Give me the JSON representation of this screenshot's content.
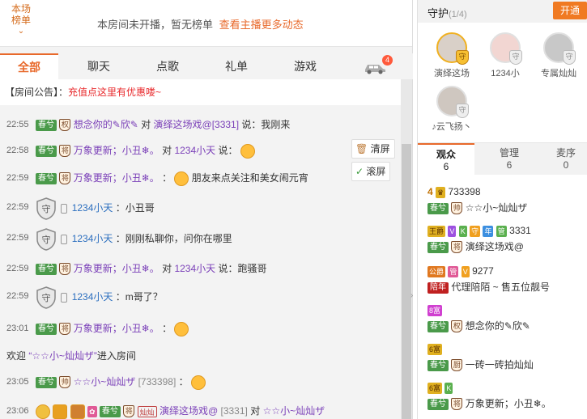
{
  "rank": {
    "tab_line1": "本场",
    "tab_line2": "榜单",
    "message": "本房间未开播，暂无榜单",
    "link": "查看主播更多动态"
  },
  "tabs": [
    {
      "label": "全部"
    },
    {
      "label": "聊天"
    },
    {
      "label": "点歌"
    },
    {
      "label": "礼单"
    },
    {
      "label": "游戏"
    }
  ],
  "car_badge": "4",
  "notice": {
    "prefix": "【房间公告】：",
    "text": "充值点这里有优惠喽~"
  },
  "buttons": {
    "clear": "清屏",
    "scroll": "滚屏"
  },
  "chat": [
    {
      "time": "22:55",
      "badge": "春兮",
      "level": "权",
      "user": "想念你的✎欣✎",
      "to": "对",
      "target": "演绎这场戏@[3331]",
      "verb": "说：",
      "text": "我刚来"
    },
    {
      "time": "22:58",
      "badge": "春兮",
      "level": "将",
      "user": "万象更新；小丑❄。",
      "to": "对",
      "target": "1234小天",
      "verb": "说：",
      "text": ""
    },
    {
      "time": "22:59",
      "badge": "春兮",
      "level": "将",
      "user": "万象更新；小丑❄。",
      "to": "",
      "target": "",
      "verb": "：",
      "text": "朋友来点关注和美女闹元宵"
    },
    {
      "time": "22:59",
      "user": "1234小天",
      "verb": "：",
      "text": "小丑哥"
    },
    {
      "time": "22:59",
      "user": "1234小天",
      "verb": "：",
      "text": "刚刚私聊你，问你在哪里"
    },
    {
      "time": "22:59",
      "badge": "春兮",
      "level": "将",
      "user": "万象更新；小丑❄。",
      "to": "对",
      "target": "1234小天",
      "verb": "说：",
      "text": "跑骚哥"
    },
    {
      "time": "22:59",
      "user": "1234小天",
      "verb": "：",
      "text": "m哥了？"
    },
    {
      "time": "23:01",
      "badge": "春兮",
      "level": "将",
      "user": "万象更新；小丑❄。",
      "to": "",
      "target": "",
      "verb": "：",
      "text": ""
    },
    {
      "enter_prefix": "欢迎 ",
      "enter_user": "“☆☆小~灿灿ザ”",
      "enter_suffix": "进入房间"
    },
    {
      "time": "23:05",
      "badge": "春兮",
      "level": "帅",
      "user": "☆☆小~灿灿ザ",
      "extra": "[733398]",
      "verb": "："
    },
    {
      "time": "23:06",
      "badge": "春兮",
      "level": "将",
      "user": "演绎这场戏@",
      "extra": "[3331]",
      "to": "对",
      "target": "☆☆小~灿灿ザ",
      "mini_label": "灿灿"
    }
  ],
  "guard": {
    "title": "守护",
    "count": "(1/4)",
    "open": "开通",
    "members": [
      {
        "name": "演绎这场"
      },
      {
        "name": "1234小"
      },
      {
        "name": "专属灿灿"
      },
      {
        "name": "♪云飞扬丶"
      }
    ]
  },
  "aud_tabs": [
    {
      "label": "观众",
      "count": "6"
    },
    {
      "label": "管理",
      "count": "6"
    },
    {
      "label": "麦序",
      "count": "0"
    }
  ],
  "audience": [
    {
      "rank": "4",
      "id": "733398",
      "badge": "春兮",
      "level": "帅",
      "name": "☆☆小~灿灿ザ"
    },
    {
      "tags": [
        "王爵",
        "V",
        "K",
        "守",
        "年",
        "管"
      ],
      "id": "3331",
      "badge": "春兮",
      "level": "将",
      "name": "演绎这场戏@"
    },
    {
      "tags": [
        "公爵",
        "管",
        "V"
      ],
      "id": "9277",
      "badge": "陪年",
      "name": "代理陪陌 ~ 售五位靓号"
    },
    {
      "tags": [
        "8富"
      ],
      "badge": "春兮",
      "level": "权",
      "name": "想念你的✎欣✎"
    },
    {
      "tags": [
        "6富"
      ],
      "badge": "春兮",
      "level": "厨",
      "name": "一砖一砖拍灿灿"
    },
    {
      "tags": [
        "6富",
        "K"
      ],
      "badge": "春兮",
      "level": "将",
      "name": "万象更新；小丑❄。"
    }
  ],
  "colors": {
    "accent": "#e8692b",
    "username": "#7a3fb8",
    "target": "#2c6fbf"
  }
}
